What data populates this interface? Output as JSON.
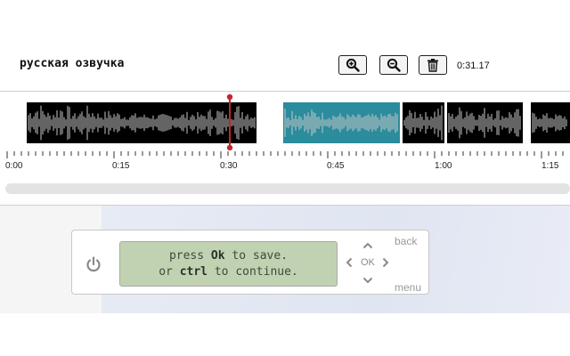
{
  "track": {
    "title": "русская озвучка"
  },
  "toolbar": {
    "zoom_in_icon": "zoom-in-icon",
    "zoom_out_icon": "zoom-out-icon",
    "delete_icon": "trash-icon"
  },
  "time_readout": "0:31.17",
  "timeline": {
    "ticks": [
      "0:00",
      "0:15",
      "0:30",
      "0:45",
      "1:00",
      "1:15"
    ],
    "playhead_seconds": 31.17
  },
  "colors": {
    "waveform_bg": "#000000",
    "waveform_wave": "#c8c8c8",
    "selection": "#2a8c9c",
    "playhead": "#c0272d"
  },
  "device": {
    "lcd_line1_pre": "press ",
    "lcd_line1_bold": "Ok",
    "lcd_line1_post": " to save.",
    "lcd_line2_pre": "or ",
    "lcd_line2_bold": "ctrl",
    "lcd_line2_post": " to continue.",
    "ok_label": "OK",
    "back_label": "back",
    "menu_label": "menu"
  }
}
